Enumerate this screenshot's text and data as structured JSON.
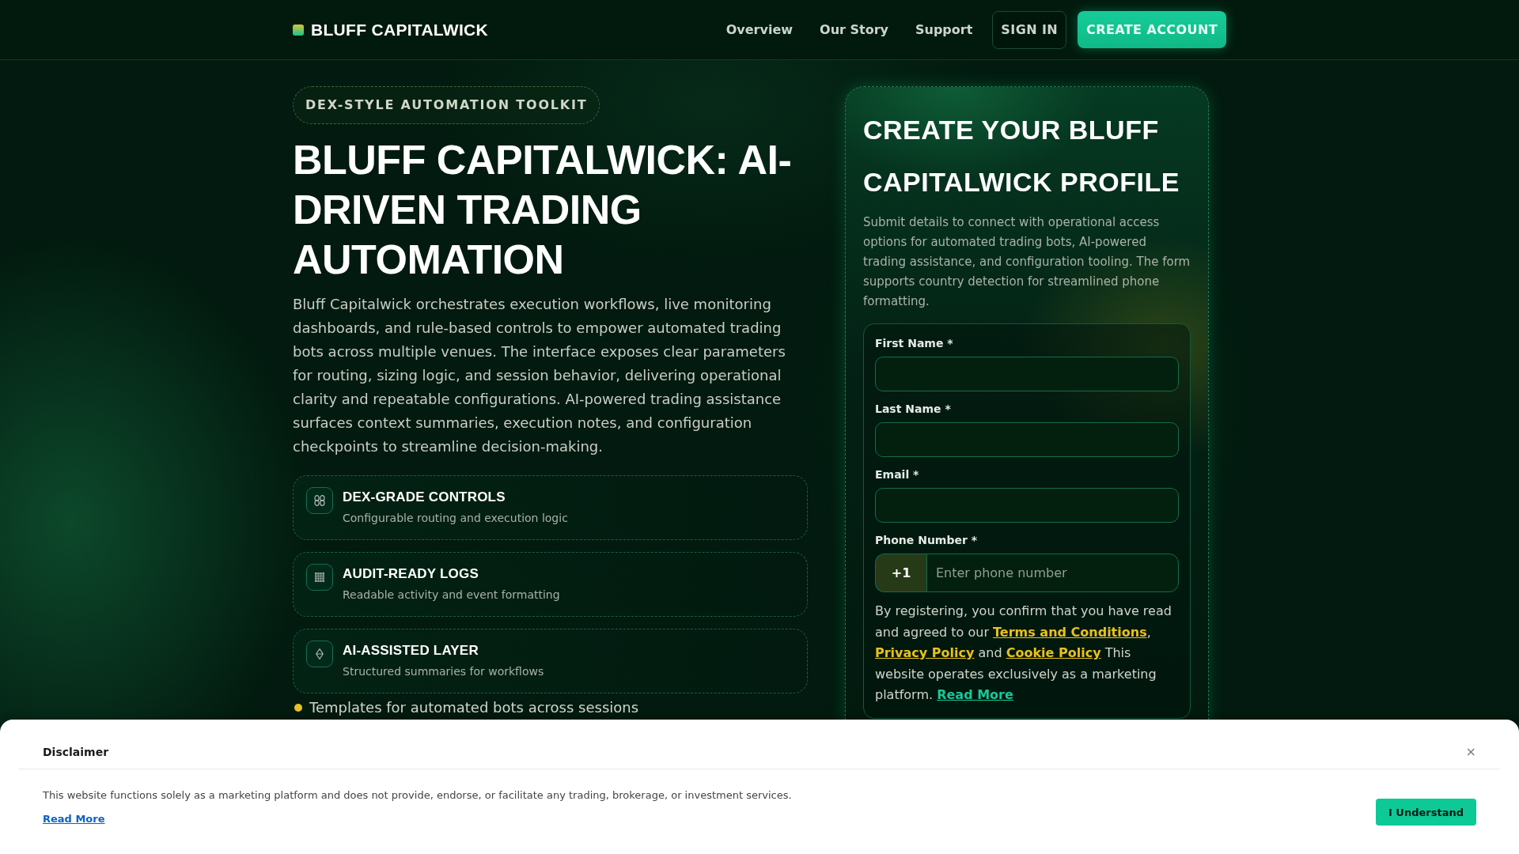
{
  "header": {
    "brand": "BLUFF CAPITALWICK",
    "nav": [
      {
        "label": "Overview"
      },
      {
        "label": "Our Story"
      },
      {
        "label": "Support"
      }
    ],
    "actions": [
      {
        "label": "SIGN IN",
        "kind": "outline"
      },
      {
        "label": "CREATE ACCOUNT",
        "kind": "filled"
      }
    ]
  },
  "hero": {
    "badge": "DEX-STYLE AUTOMATION TOOLKIT",
    "title": "BLUFF CAPITALWICK: AI-DRIVEN TRADING AUTOMATION",
    "description": "Bluff Capitalwick orchestrates execution workflows, live monitoring dashboards, and rule-based controls to empower automated trading bots across multiple venues. The interface exposes clear parameters for routing, sizing logic, and session behavior, delivering operational clarity and repeatable configurations. AI-powered trading assistance surfaces context summaries, execution notes, and configuration checkpoints to streamline decision-making.",
    "features": [
      {
        "title": "DEX-GRADE CONTROLS",
        "subtitle": "Configurable routing and execution logic"
      },
      {
        "title": "AUDIT-READY LOGS",
        "subtitle": "Readable activity and event formatting"
      },
      {
        "title": "AI-ASSISTED LAYER",
        "subtitle": "Structured summaries for workflows"
      }
    ],
    "bullets": [
      {
        "text": "Templates for automated bots across sessions"
      }
    ]
  },
  "signup": {
    "title": "CREATE YOUR BLUFF CAPITALWICK PROFILE",
    "description": "Submit details to connect with operational access options for automated trading bots, AI-powered trading assistance, and configuration tooling. The form supports country detection for streamlined phone formatting.",
    "fields": [
      {
        "label": "First Name *"
      },
      {
        "label": "Last Name *"
      },
      {
        "label": "Email *"
      },
      {
        "label": "Phone Number *",
        "prefix": "+1",
        "placeholder": "Enter phone number"
      }
    ],
    "consent": [
      {
        "kind": "text",
        "text": "By registering, you confirm that you have read and agreed to our "
      },
      {
        "kind": "policy",
        "text": "Terms and Conditions"
      },
      {
        "kind": "text",
        "text": ", "
      },
      {
        "kind": "policy",
        "text": "Privacy Policy"
      },
      {
        "kind": "text",
        "text": " and "
      },
      {
        "kind": "policy",
        "text": "Cookie Policy"
      },
      {
        "kind": "text",
        "text": " This website operates exclusively as a marketing platform. "
      },
      {
        "kind": "more",
        "text": "Read More"
      }
    ]
  },
  "disclaimer": {
    "title": "Disclaimer",
    "close": "×",
    "text": "This website functions solely as a marketing platform and does not provide, endorse, or facilitate any trading, brokerage, or investment services.",
    "link": "Read More",
    "button": "I Understand"
  }
}
